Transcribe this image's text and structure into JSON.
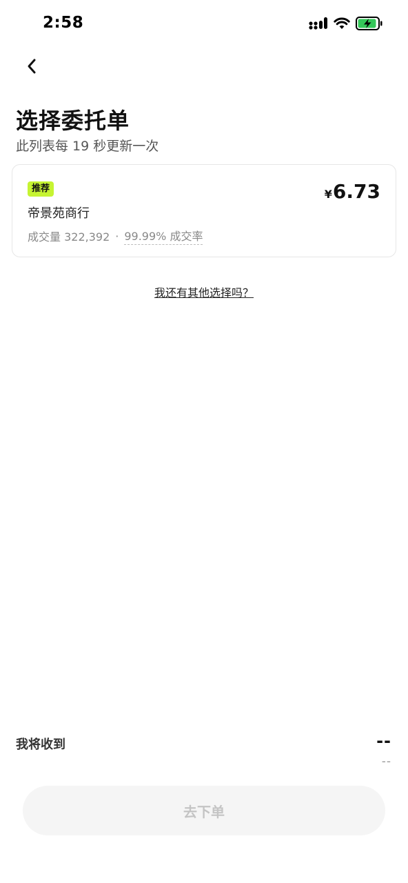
{
  "status": {
    "time": "2:58",
    "battery_color": "#34c759"
  },
  "header": {
    "title": "选择委托单",
    "subtitle": "此列表每 19 秒更新一次"
  },
  "order": {
    "badge": "推荐",
    "merchant": "帝景苑商行",
    "volume": "成交量 322,392",
    "separator": "·",
    "completion_rate": "99.99% 成交率",
    "currency": "¥",
    "price": "6.73",
    "badge_color": "#c6f432"
  },
  "other_options": "我还有其他选择吗？",
  "summary": {
    "label": "我将收到",
    "value": "--",
    "sub_value": "--"
  },
  "submit_button": "去下单",
  "icons": {
    "back": "chevron-left-icon",
    "signal": "signal-icon",
    "wifi": "wifi-icon",
    "battery": "battery-charging-icon"
  }
}
